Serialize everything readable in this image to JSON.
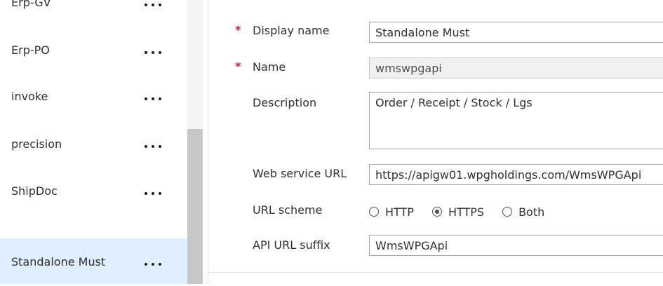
{
  "sidebar": {
    "items": [
      {
        "label": "Erp-GV",
        "selected": false
      },
      {
        "label": "Erp-PO",
        "selected": false
      },
      {
        "label": "invoke",
        "selected": false
      },
      {
        "label": "precision",
        "selected": false
      },
      {
        "label": "ShipDoc",
        "selected": false
      },
      {
        "label": "Standalone Must",
        "selected": true
      }
    ],
    "more_icon": "ellipsis-icon",
    "selected_color": "#dfefff"
  },
  "form": {
    "required_marker": "*",
    "display_name": {
      "label": "Display name",
      "value": "Standalone Must"
    },
    "name": {
      "label": "Name",
      "value": "wmswpgapi"
    },
    "description": {
      "label": "Description",
      "value": "Order / Receipt / Stock / Lgs"
    },
    "web_service_url": {
      "label": "Web service URL",
      "value": "https://apigw01.wpgholdings.com/WmsWPGApi"
    },
    "url_scheme": {
      "label": "URL scheme",
      "options": [
        {
          "label": "HTTP",
          "checked": false
        },
        {
          "label": "HTTPS",
          "checked": true
        },
        {
          "label": "Both",
          "checked": false
        }
      ]
    },
    "api_url_suffix": {
      "label": "API URL suffix",
      "value": "WmsWPGApi"
    }
  }
}
